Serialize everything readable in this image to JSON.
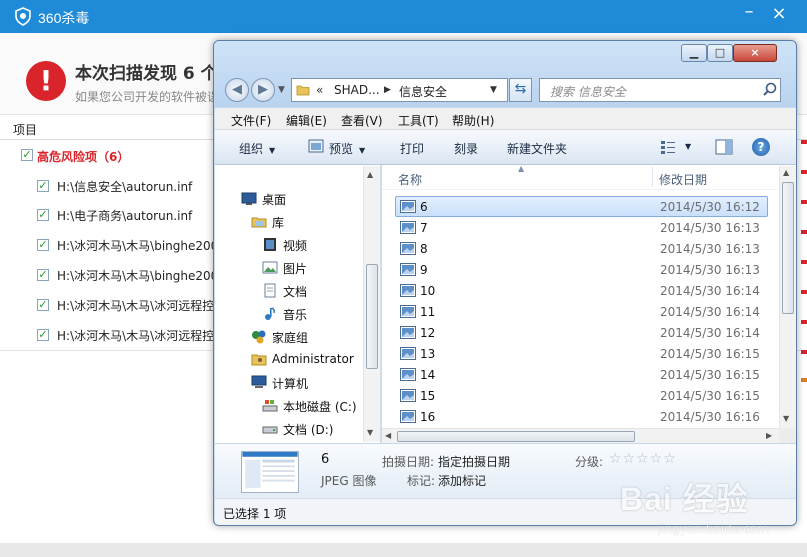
{
  "av_app": {
    "title": "360杀毒",
    "headline": "本次扫描发现 6 个",
    "subline": "如果您公司开发的软件被误",
    "column_header": "项目",
    "group": {
      "label": "高危风险项（6）",
      "checked": true
    },
    "items": [
      {
        "path": "H:\\信息安全\\autorun.inf",
        "checked": true
      },
      {
        "path": "H:\\电子商务\\autorun.inf",
        "checked": true
      },
      {
        "path": "H:\\冰河木马\\木马\\binghe200",
        "checked": true
      },
      {
        "path": "H:\\冰河木马\\木马\\binghe200",
        "checked": true
      },
      {
        "path": "H:\\冰河木马\\木马\\冰河远程控",
        "checked": true
      },
      {
        "path": "H:\\冰河木马\\木马\\冰河远程控",
        "checked": true
      }
    ],
    "colors": {
      "titlebar": "#1e8ad8",
      "danger": "#d8242a",
      "check": "#1e9a2a"
    }
  },
  "explorer": {
    "address": {
      "prefix": "«",
      "segments": [
        "SHAD...",
        "信息安全"
      ]
    },
    "search_placeholder": "搜索 信息安全",
    "menu": [
      "文件(F)",
      "编辑(E)",
      "查看(V)",
      "工具(T)",
      "帮助(H)"
    ],
    "toolbar": {
      "organize": "组织",
      "preview": "预览",
      "print": "打印",
      "burn": "刻录",
      "new_folder": "新建文件夹"
    },
    "nav_tree": [
      {
        "label": "桌面",
        "icon": "desktop-icon"
      },
      {
        "label": "库",
        "icon": "library-icon"
      },
      {
        "label": "视频",
        "icon": "video-icon"
      },
      {
        "label": "图片",
        "icon": "pictures-icon"
      },
      {
        "label": "文档",
        "icon": "documents-icon"
      },
      {
        "label": "音乐",
        "icon": "music-icon"
      },
      {
        "label": "家庭组",
        "icon": "homegroup-icon"
      },
      {
        "label": "Administrator",
        "icon": "user-folder-icon"
      },
      {
        "label": "计算机",
        "icon": "computer-icon"
      },
      {
        "label": "本地磁盘 (C:)",
        "icon": "system-drive-icon"
      },
      {
        "label": "文档 (D:)",
        "icon": "drive-icon"
      }
    ],
    "columns": {
      "name": "名称",
      "date": "修改日期"
    },
    "files": [
      {
        "name": "6",
        "date": "2014/5/30 16:12",
        "selected": true
      },
      {
        "name": "7",
        "date": "2014/5/30 16:13",
        "selected": false
      },
      {
        "name": "8",
        "date": "2014/5/30 16:13",
        "selected": false
      },
      {
        "name": "9",
        "date": "2014/5/30 16:13",
        "selected": false
      },
      {
        "name": "10",
        "date": "2014/5/30 16:14",
        "selected": false
      },
      {
        "name": "11",
        "date": "2014/5/30 16:14",
        "selected": false
      },
      {
        "name": "12",
        "date": "2014/5/30 16:14",
        "selected": false
      },
      {
        "name": "13",
        "date": "2014/5/30 16:15",
        "selected": false
      },
      {
        "name": "14",
        "date": "2014/5/30 16:15",
        "selected": false
      },
      {
        "name": "15",
        "date": "2014/5/30 16:15",
        "selected": false
      },
      {
        "name": "16",
        "date": "2014/5/30 16:16",
        "selected": false
      }
    ],
    "details": {
      "name": "6",
      "type": "JPEG 图像",
      "date_taken_label": "拍摄日期:",
      "date_taken_value": "指定拍摄日期",
      "tags_label": "标记:",
      "tags_value": "添加标记",
      "rating_label": "分级:",
      "rating_stars": "☆☆☆☆☆",
      "rating_value": 0
    },
    "status": "已选择 1 项"
  },
  "watermark": {
    "text": "Bai 经验",
    "url": "jingyan.baidu.com"
  }
}
